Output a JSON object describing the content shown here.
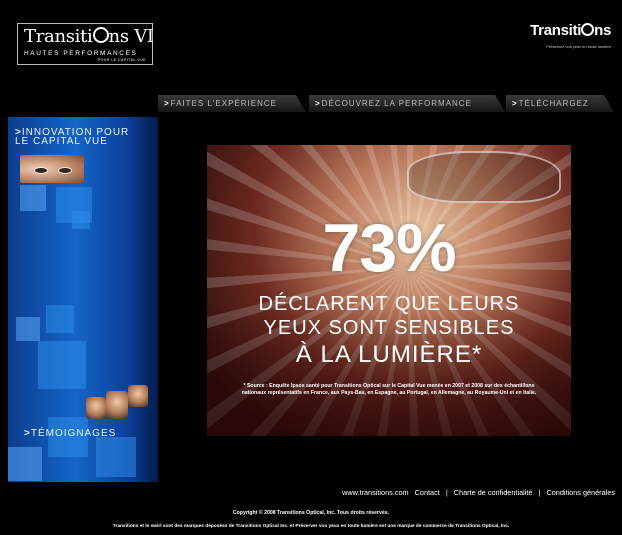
{
  "header": {
    "logo_name_pre": "Transiti",
    "logo_name_post": "ns",
    "logo_version": "VI",
    "logo_subtitle": "HAUTES PERFORMANCES",
    "logo_subtitle2": "POUR LE CAPITAL VUE",
    "brand_pre": "Transiti",
    "brand_post": "ns",
    "brand_tagline": "Préservez vos yeux en toute lumière"
  },
  "nav": {
    "arrow": ">",
    "tabs": [
      {
        "label": "Faites l'expérience"
      },
      {
        "label": "Découvrez la performance"
      },
      {
        "label": "Téléchargez"
      }
    ]
  },
  "sidebar": {
    "arrow": ">",
    "title_line1": "Innovation pour",
    "title_line2": "le Capital Vue",
    "testimonials": "Témoignages"
  },
  "hero": {
    "percent": "73%",
    "line1": "DÉCLARENT QUE LEURS",
    "line2": "YEUX SONT SENSIBLES",
    "line3": "À LA LUMIÈRE*",
    "source": "* Source : Enquête Ipsos santé pour Transitions Optical sur le Capital Vue menée en 2007 et 2008 sur des échantillons nationaux représentatifs en France, aux Pays-Bas, en Espagne, au Portugal, en Allemagne, au Royaume-Uni et en Italie."
  },
  "footer": {
    "links": [
      {
        "label": "www.transitions.com"
      },
      {
        "label": "Contact"
      },
      {
        "label": "Charte de confidentialité"
      },
      {
        "label": "Conditions générales"
      }
    ],
    "separator": "|",
    "copyright": "Copyright © 2008 Transitions Optical, Inc. Tous droits réservés.",
    "legal": "Transitions et le swirl sont des marques déposées de Transitions Optical Inc. et Préserver vos yeux en toute lumière est une marque de commerce de Transitions Optical, Inc."
  }
}
